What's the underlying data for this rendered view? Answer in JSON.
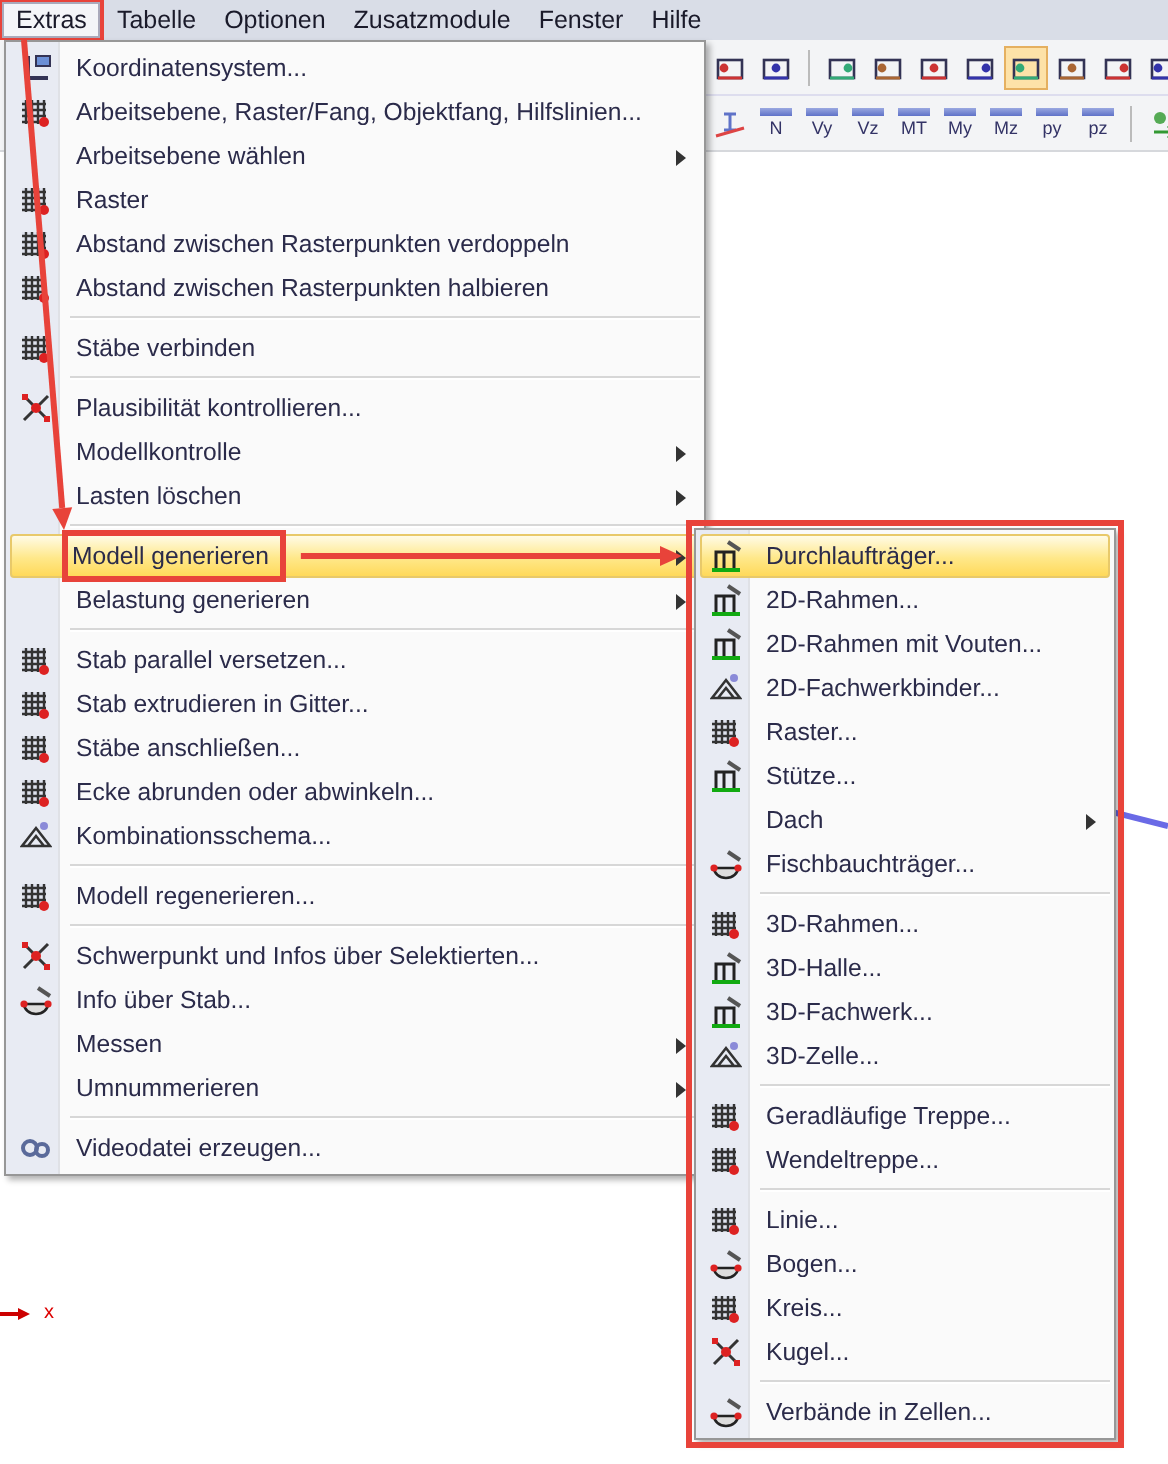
{
  "menu_bar": [
    {
      "label": "Extras",
      "selected": true,
      "outlined": true
    },
    {
      "label": "Tabelle",
      "selected": false,
      "outlined": false
    },
    {
      "label": "Optionen",
      "selected": false,
      "outlined": false
    },
    {
      "label": "Zusatzmodule",
      "selected": false,
      "outlined": false
    },
    {
      "label": "Fenster",
      "selected": false,
      "outlined": false
    },
    {
      "label": "Hilfe",
      "selected": false,
      "outlined": false
    }
  ],
  "toolbar": {
    "buttons": [
      {
        "selected": false
      },
      {
        "selected": false
      },
      {
        "selected": false
      },
      {
        "selected": false
      },
      {
        "selected": false
      },
      {
        "selected": false
      },
      {
        "selected": true
      },
      {
        "selected": false
      },
      {
        "selected": false
      },
      {
        "selected": false
      }
    ],
    "result_buttons": [
      {
        "label": "N"
      },
      {
        "label": "Vy"
      },
      {
        "label": "Vz"
      },
      {
        "label": "MT"
      },
      {
        "label": "My"
      },
      {
        "label": "Mz"
      },
      {
        "label": "py"
      },
      {
        "label": "pz"
      }
    ]
  },
  "menu": {
    "items": [
      {
        "kind": "item",
        "label": "Koordinatensystem...",
        "icon": true,
        "submenu": false,
        "selected": false,
        "outlined": false
      },
      {
        "kind": "item",
        "label": "Arbeitsebene, Raster/Fang, Objektfang, Hilfslinien...",
        "icon": true,
        "submenu": false,
        "selected": false,
        "outlined": false
      },
      {
        "kind": "item",
        "label": "Arbeitsebene wählen",
        "icon": false,
        "submenu": true,
        "selected": false,
        "outlined": false
      },
      {
        "kind": "item",
        "label": "Raster",
        "icon": true,
        "submenu": false,
        "selected": false,
        "outlined": false
      },
      {
        "kind": "item",
        "label": "Abstand zwischen Rasterpunkten verdoppeln",
        "icon": true,
        "submenu": false,
        "selected": false,
        "outlined": false
      },
      {
        "kind": "item",
        "label": "Abstand zwischen Rasterpunkten halbieren",
        "icon": true,
        "submenu": false,
        "selected": false,
        "outlined": false
      },
      {
        "kind": "separator"
      },
      {
        "kind": "item",
        "label": "Stäbe verbinden",
        "icon": true,
        "submenu": false,
        "selected": false,
        "outlined": false
      },
      {
        "kind": "separator"
      },
      {
        "kind": "item",
        "label": "Plausibilität kontrollieren...",
        "icon": true,
        "submenu": false,
        "selected": false,
        "outlined": false
      },
      {
        "kind": "item",
        "label": "Modellkontrolle",
        "icon": false,
        "submenu": true,
        "selected": false,
        "outlined": false
      },
      {
        "kind": "item",
        "label": "Lasten löschen",
        "icon": false,
        "submenu": true,
        "selected": false,
        "outlined": false
      },
      {
        "kind": "separator"
      },
      {
        "kind": "item",
        "label": "Modell generieren",
        "icon": false,
        "submenu": true,
        "selected": true,
        "outlined": true
      },
      {
        "kind": "item",
        "label": "Belastung generieren",
        "icon": false,
        "submenu": true,
        "selected": false,
        "outlined": false
      },
      {
        "kind": "separator"
      },
      {
        "kind": "item",
        "label": "Stab parallel versetzen...",
        "icon": true,
        "submenu": false,
        "selected": false,
        "outlined": false
      },
      {
        "kind": "item",
        "label": "Stab extrudieren in Gitter...",
        "icon": true,
        "submenu": false,
        "selected": false,
        "outlined": false
      },
      {
        "kind": "item",
        "label": "Stäbe anschließen...",
        "icon": true,
        "submenu": false,
        "selected": false,
        "outlined": false
      },
      {
        "kind": "item",
        "label": "Ecke abrunden oder abwinkeln...",
        "icon": true,
        "submenu": false,
        "selected": false,
        "outlined": false
      },
      {
        "kind": "item",
        "label": "Kombinationsschema...",
        "icon": true,
        "submenu": false,
        "selected": false,
        "outlined": false
      },
      {
        "kind": "separator"
      },
      {
        "kind": "item",
        "label": "Modell regenerieren...",
        "icon": true,
        "submenu": false,
        "selected": false,
        "outlined": false
      },
      {
        "kind": "separator"
      },
      {
        "kind": "item",
        "label": "Schwerpunkt und Infos über Selektierten...",
        "icon": true,
        "submenu": false,
        "selected": false,
        "outlined": false
      },
      {
        "kind": "item",
        "label": "Info über Stab...",
        "icon": true,
        "submenu": false,
        "selected": false,
        "outlined": false
      },
      {
        "kind": "item",
        "label": "Messen",
        "icon": false,
        "submenu": true,
        "selected": false,
        "outlined": false
      },
      {
        "kind": "item",
        "label": "Umnummerieren",
        "icon": false,
        "submenu": true,
        "selected": false,
        "outlined": false
      },
      {
        "kind": "separator"
      },
      {
        "kind": "item",
        "label": "Videodatei erzeugen...",
        "icon": true,
        "submenu": false,
        "selected": false,
        "outlined": false
      }
    ]
  },
  "submenu": {
    "outlined": true,
    "items": [
      {
        "kind": "item",
        "label": "Durchlaufträger...",
        "icon": true,
        "submenu": false,
        "selected": true,
        "outlined": false
      },
      {
        "kind": "item",
        "label": "2D-Rahmen...",
        "icon": true,
        "submenu": false,
        "selected": false,
        "outlined": false
      },
      {
        "kind": "item",
        "label": "2D-Rahmen mit Vouten...",
        "icon": true,
        "submenu": false,
        "selected": false,
        "outlined": false
      },
      {
        "kind": "item",
        "label": "2D-Fachwerkbinder...",
        "icon": true,
        "submenu": false,
        "selected": false,
        "outlined": false
      },
      {
        "kind": "item",
        "label": "Raster...",
        "icon": true,
        "submenu": false,
        "selected": false,
        "outlined": false
      },
      {
        "kind": "item",
        "label": "Stütze...",
        "icon": true,
        "submenu": false,
        "selected": false,
        "outlined": false
      },
      {
        "kind": "item",
        "label": "Dach",
        "icon": false,
        "submenu": true,
        "selected": false,
        "outlined": false
      },
      {
        "kind": "item",
        "label": "Fischbauchträger...",
        "icon": true,
        "submenu": false,
        "selected": false,
        "outlined": false
      },
      {
        "kind": "separator"
      },
      {
        "kind": "item",
        "label": "3D-Rahmen...",
        "icon": true,
        "submenu": false,
        "selected": false,
        "outlined": false
      },
      {
        "kind": "item",
        "label": "3D-Halle...",
        "icon": true,
        "submenu": false,
        "selected": false,
        "outlined": false
      },
      {
        "kind": "item",
        "label": "3D-Fachwerk...",
        "icon": true,
        "submenu": false,
        "selected": false,
        "outlined": false
      },
      {
        "kind": "item",
        "label": "3D-Zelle...",
        "icon": true,
        "submenu": false,
        "selected": false,
        "outlined": false
      },
      {
        "kind": "separator"
      },
      {
        "kind": "item",
        "label": "Geradläufige Treppe...",
        "icon": true,
        "submenu": false,
        "selected": false,
        "outlined": false
      },
      {
        "kind": "item",
        "label": "Wendeltreppe...",
        "icon": true,
        "submenu": false,
        "selected": false,
        "outlined": false
      },
      {
        "kind": "separator"
      },
      {
        "kind": "item",
        "label": "Linie...",
        "icon": true,
        "submenu": false,
        "selected": false,
        "outlined": false
      },
      {
        "kind": "item",
        "label": "Bogen...",
        "icon": true,
        "submenu": false,
        "selected": false,
        "outlined": false
      },
      {
        "kind": "item",
        "label": "Kreis...",
        "icon": true,
        "submenu": false,
        "selected": false,
        "outlined": false
      },
      {
        "kind": "item",
        "label": "Kugel...",
        "icon": true,
        "submenu": false,
        "selected": false,
        "outlined": false
      },
      {
        "kind": "separator"
      },
      {
        "kind": "item",
        "label": "Verbände in Zellen...",
        "icon": true,
        "submenu": false,
        "selected": false,
        "outlined": false
      }
    ]
  },
  "arrows": {
    "down": true,
    "right": true
  },
  "canvas": {
    "axis_label": "x"
  }
}
